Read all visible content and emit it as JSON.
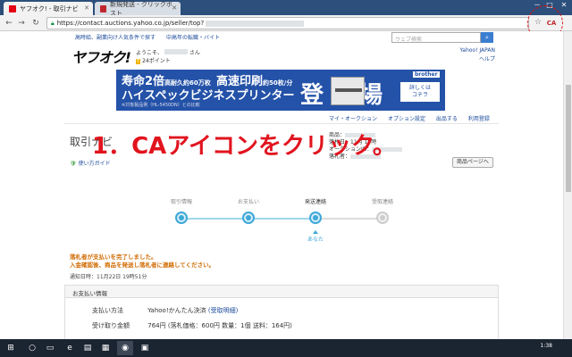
{
  "browser": {
    "tabs": [
      {
        "title": "ヤフオク! - 取引ナビ",
        "favicon_color": "#e60012"
      },
      {
        "title": "新規発送 - クリックポスト",
        "favicon_color": "#c0262d"
      }
    ],
    "url": "https://contact.auctions.yahoo.co.jp/seller/top?",
    "ca_label": "CA",
    "window_controls": [
      "－",
      "□",
      "✕"
    ]
  },
  "header": {
    "top_links": [
      "高時給、副業向け人気条件で探す",
      "中高年の転職・バイト"
    ],
    "search_placeholder": "ウェブ検索",
    "search_icon": "search-icon",
    "logo": "ヤフオク!",
    "welcome_prefix": "ようこそ、",
    "welcome_suffix": "さん",
    "points": "24ポイント",
    "tpoint_badge": "T",
    "yahoo_japan": "Yahoo! JAPAN",
    "help": "ヘルプ"
  },
  "banner": {
    "line1_a": "寿命2倍",
    "line1_a_small": "高耐久約60万枚",
    "line1_b": "高速印刷",
    "line1_b_small": "約50枚/分",
    "line2": "ハイスペックビジネスプリンター",
    "fineprint": "※対象製品例（HL-5450DN）との比較",
    "big": "登場",
    "big_left": "登",
    "big_right": "場",
    "brand": "brother",
    "detail_line1": "詳しくは",
    "detail_line2": "コチラ"
  },
  "my_links": [
    "マイ・オークション",
    "オプション設定",
    "出品する",
    "利用登録"
  ],
  "title": "取引ナビ",
  "guide": "使い方ガイド",
  "info": {
    "row1_label": "商品：",
    "row2_label": "落札日：11月",
    "row2_suffix": "19時",
    "row3_label": "オークションID：",
    "row4_label": "落札者："
  },
  "product_button": "商品ページへ",
  "overlay_text": "1．CAアイコンをクリック。",
  "steps": [
    {
      "label": "取引情報",
      "state": "done"
    },
    {
      "label": "お支払い",
      "state": "done"
    },
    {
      "label": "発送連絡",
      "state": "current"
    },
    {
      "label": "受取連絡",
      "state": "pending"
    }
  ],
  "you_label": "あなた",
  "notice": {
    "line1": "落札者が支払いを完了しました。",
    "line2": "入金確認後、商品を発送し落札者に連絡してください。",
    "date": "通知日時：11月22日 19時51分"
  },
  "payment": {
    "heading": "お支払い情報",
    "method_label": "支払い方法",
    "method_value": "Yahoo!かんたん決済",
    "method_link": "(受取明細)",
    "amount_label": "受け取り金額",
    "amount_value": "764円 (落札価格：600円 数量：1個 送料：164円)"
  },
  "taskbar": {
    "time": "1:38"
  }
}
